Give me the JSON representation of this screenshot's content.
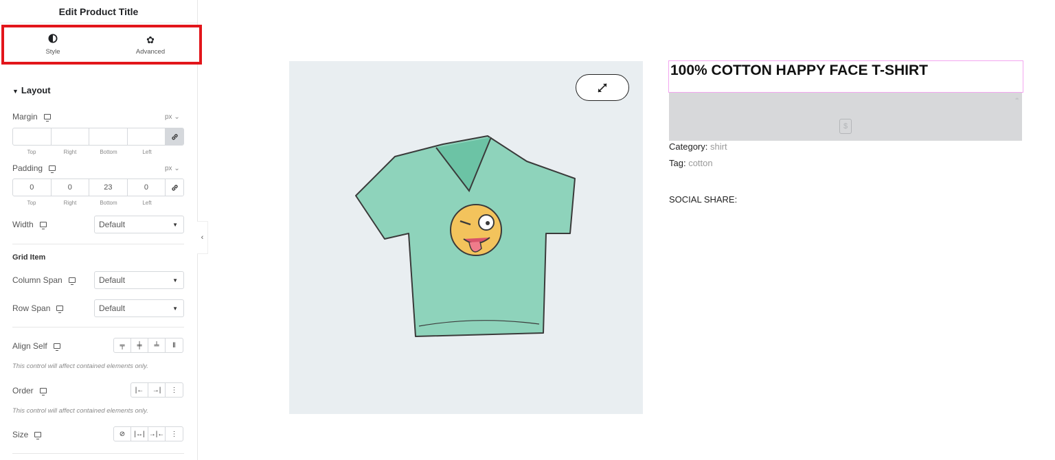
{
  "panel": {
    "title": "Edit Product Title",
    "tabs": [
      {
        "label": "Style",
        "icon": "contrast-icon"
      },
      {
        "label": "Advanced",
        "icon": "gear-icon"
      }
    ],
    "section": "Layout",
    "margin": {
      "label": "Margin",
      "unit": "px ⌄",
      "values": [
        "",
        "",
        "",
        ""
      ],
      "labels": [
        "Top",
        "Right",
        "Bottom",
        "Left"
      ]
    },
    "padding": {
      "label": "Padding",
      "unit": "px ⌄",
      "values": [
        "0",
        "0",
        "23",
        "0"
      ],
      "labels": [
        "Top",
        "Right",
        "Bottom",
        "Left"
      ]
    },
    "width": {
      "label": "Width",
      "value": "Default"
    },
    "grid_item": "Grid Item",
    "column_span": {
      "label": "Column Span",
      "value": "Default"
    },
    "row_span": {
      "label": "Row Span",
      "value": "Default"
    },
    "align_self": {
      "label": "Align Self"
    },
    "note": "This control will affect contained elements only.",
    "order": {
      "label": "Order"
    },
    "size": {
      "label": "Size"
    }
  },
  "product": {
    "title": "100% COTTON HAPPY FACE T-SHIRT",
    "category_label": "Category:",
    "category": "shirt",
    "tag_label": "Tag:",
    "tag": "cotton",
    "social_share": "SOCIAL SHARE:"
  },
  "colors": {
    "highlight": "#e2161b",
    "title_outline": "#f3a6f0",
    "shirt": "#8ed3bb"
  }
}
